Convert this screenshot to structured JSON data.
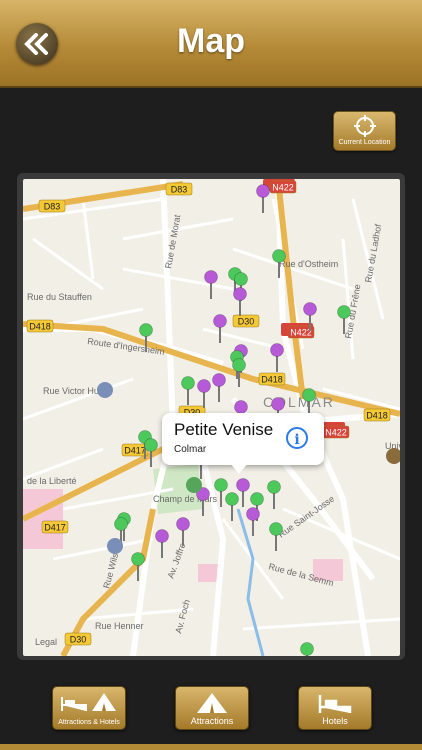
{
  "header": {
    "title": "Map",
    "back_icon": "double-chevron-left-icon"
  },
  "location_button": {
    "label": "Current Location",
    "icon": "crosshair-icon"
  },
  "map": {
    "road_labels": [
      "D83",
      "D83",
      "N422",
      "D418",
      "D30",
      "N422",
      "D418",
      "D30",
      "D418",
      "D417",
      "N422",
      "D417",
      "D30"
    ],
    "street_labels": [
      "Rue du Stauffen",
      "Rue de Morat",
      "Rue d'Ostheim",
      "Rue du Ladhof",
      "Route d'Ingersheim",
      "Rue du Frêne",
      "Rue Victor Huen",
      "COLMAR",
      "de la Liberté",
      "Champ de Mars",
      "Univers Haute A U.H.",
      "Rue Saint-Josse",
      "Rue de la Semm",
      "Rue Wilson",
      "Av. Joffre",
      "Av. Foch",
      "Rue Henner",
      "Legal"
    ],
    "pin_colors": {
      "green": "#4cc95a",
      "purple": "#b75ad8"
    }
  },
  "callout": {
    "title": "Petite Venise",
    "subtitle": "Colmar",
    "info_icon": "i"
  },
  "toolbar": {
    "items": [
      {
        "label": "Attractions & Hotels",
        "icon": "bed-tent-icon"
      },
      {
        "label": "Attractions",
        "icon": "tent-icon"
      },
      {
        "label": "Hotels",
        "icon": "bed-icon"
      }
    ]
  }
}
